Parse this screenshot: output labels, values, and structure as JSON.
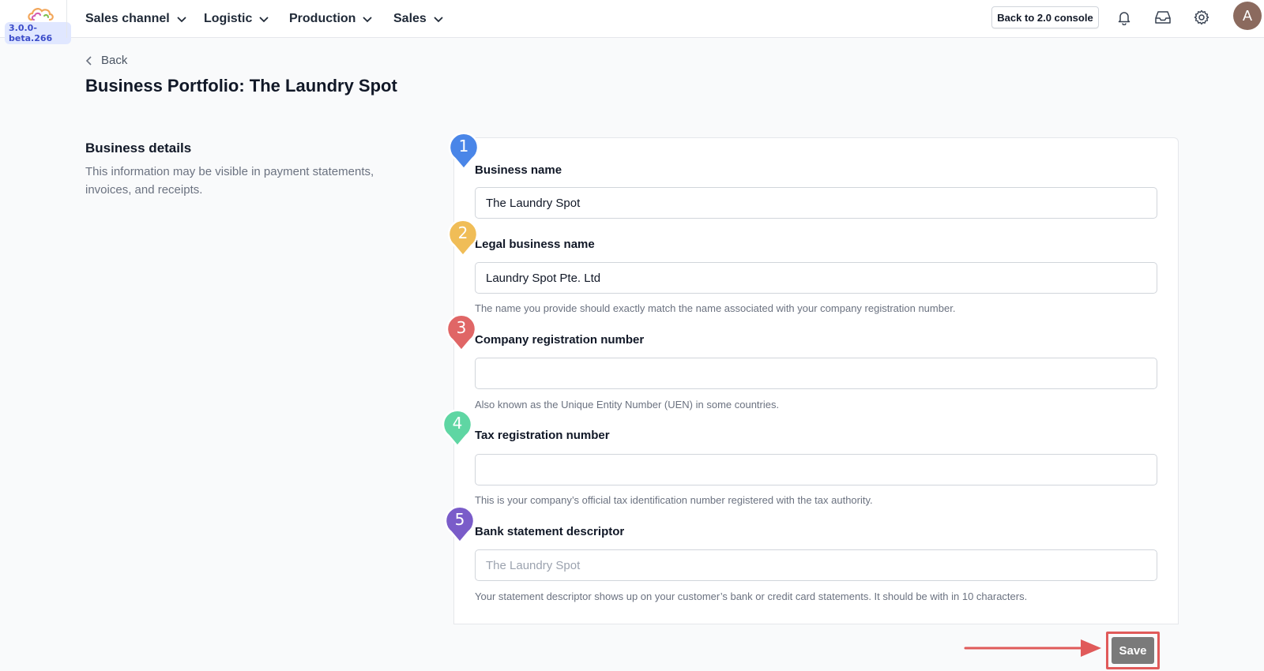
{
  "app": {
    "version": "3.0.0-beta.266"
  },
  "nav": {
    "items": [
      {
        "label": "Sales channel"
      },
      {
        "label": "Logistic"
      },
      {
        "label": "Production"
      },
      {
        "label": "Sales"
      }
    ],
    "console_button": "Back to 2.0 console",
    "icons": [
      "bell-icon",
      "inbox-icon",
      "gear-icon"
    ],
    "avatar_initial": "A"
  },
  "page": {
    "back_label": "Back",
    "title": "Business Portfolio: The Laundry Spot"
  },
  "section": {
    "title": "Business details",
    "description": "This information may be visible in payment statements, invoices, and receipts."
  },
  "fields": [
    {
      "marker": "1",
      "label": "Business name",
      "value": "The Laundry Spot",
      "placeholder": "",
      "help": ""
    },
    {
      "marker": "2",
      "label": "Legal business name",
      "value": "Laundry Spot Pte. Ltd",
      "placeholder": "",
      "help": "The name you provide should exactly match the name associated with your company registration number."
    },
    {
      "marker": "3",
      "label": "Company registration number",
      "value": "",
      "placeholder": "",
      "help": "Also known as the Unique Entity Number (UEN) in some countries."
    },
    {
      "marker": "4",
      "label": "Tax registration number",
      "value": "",
      "placeholder": "",
      "help": "This is your company’s official tax identification number registered with the tax authority."
    },
    {
      "marker": "5",
      "label": "Bank statement descriptor",
      "value": "",
      "placeholder": "The Laundry Spot",
      "help": "Your statement descriptor shows up on your customer’s bank or credit card statements. It should be with in 10 characters."
    }
  ],
  "actions": {
    "save_label": "Save"
  },
  "colors": {
    "marker_1": "#4a86e8",
    "marker_2": "#f0bd57",
    "marker_3": "#e06666",
    "marker_4": "#5fd6a3",
    "marker_5": "#7a5cc9",
    "highlight": "#e05a5a"
  }
}
